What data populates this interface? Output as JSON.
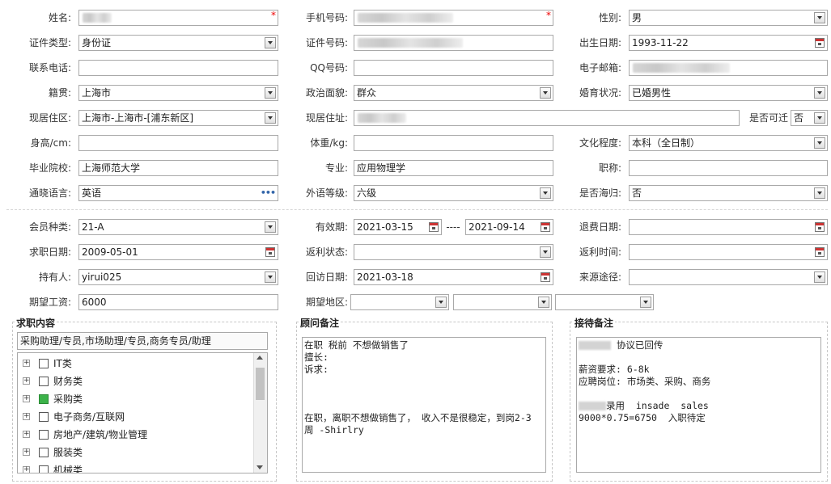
{
  "profile": {
    "name": {
      "label": "姓名:"
    },
    "mobile": {
      "label": "手机号码:"
    },
    "gender": {
      "label": "性别:",
      "value": "男"
    },
    "id_type": {
      "label": "证件类型:",
      "value": "身份证"
    },
    "id_number": {
      "label": "证件号码:"
    },
    "birth_date": {
      "label": "出生日期:",
      "value": "1993-11-22"
    },
    "phone": {
      "label": "联系电话:",
      "value": ""
    },
    "qq": {
      "label": "QQ号码:",
      "value": ""
    },
    "email": {
      "label": "电子邮箱:"
    },
    "native_place": {
      "label": "籍贯:",
      "value": "上海市"
    },
    "political": {
      "label": "政治面貌:",
      "value": "群众"
    },
    "marital": {
      "label": "婚育状况:",
      "value": "已婚男性"
    },
    "residence_area": {
      "label": "现居住区:",
      "value": "上海市-上海市-[浦东新区]"
    },
    "residence_addr": {
      "label": "现居住址:"
    },
    "relocate": {
      "label": "是否可迁",
      "value": "否"
    },
    "height": {
      "label": "身高/cm:",
      "value": ""
    },
    "weight": {
      "label": "体重/kg:",
      "value": ""
    },
    "education": {
      "label": "文化程度:",
      "value": "本科（全日制）"
    },
    "school": {
      "label": "毕业院校:",
      "value": "上海师范大学"
    },
    "major": {
      "label": "专业:",
      "value": "应用物理学"
    },
    "title": {
      "label": "职称:",
      "value": ""
    },
    "language": {
      "label": "通晓语言:",
      "value": "英语"
    },
    "lang_level": {
      "label": "外语等级:",
      "value": "六级"
    },
    "overseas": {
      "label": "是否海归:",
      "value": "否"
    }
  },
  "membership": {
    "member_type": {
      "label": "会员种类:",
      "value": "21-A"
    },
    "valid_period": {
      "label": "有效期:",
      "start": "2021-03-15",
      "sep": "----",
      "end": "2021-09-14"
    },
    "refund_date": {
      "label": "退费日期:",
      "value": ""
    },
    "job_date": {
      "label": "求职日期:",
      "value": "2009-05-01"
    },
    "rebate_status": {
      "label": "返利状态:",
      "value": ""
    },
    "rebate_time": {
      "label": "返利时间:",
      "value": ""
    },
    "holder": {
      "label": "持有人:",
      "value": "yirui025"
    },
    "visit_date": {
      "label": "回访日期:",
      "value": "2021-03-18"
    },
    "source": {
      "label": "来源途径:",
      "value": ""
    },
    "salary": {
      "label": "期望工资:",
      "value": "6000"
    },
    "region": {
      "label": "期望地区:",
      "v1": "",
      "v2": "",
      "v3": ""
    }
  },
  "job_content": {
    "title": "求职内容",
    "summary": "采购助理/专员,市场助理/专员,商务专员/助理",
    "tree": [
      {
        "label": "IT类",
        "checked": false
      },
      {
        "label": "财务类",
        "checked": false
      },
      {
        "label": "采购类",
        "checked": true
      },
      {
        "label": "电子商务/互联网",
        "checked": false
      },
      {
        "label": "房地产/建筑/物业管理",
        "checked": false
      },
      {
        "label": "服装类",
        "checked": false
      },
      {
        "label": "机械类",
        "checked": false
      }
    ]
  },
  "advisor_notes": {
    "title": "顾问备注",
    "text": "在职 税前 不想做销售了\n擅长:\n诉求:\n\n\n\n在职，离职不想做销售了， 收入不是很稳定，到岗2-3\n周 -Shirlry"
  },
  "reception_notes": {
    "title": "接待备注",
    "line1": "协议已回传",
    "body": "薪资要求: 6-8k\n应聘岗位: 市场类、采购、商务",
    "line_hire": "录用  insade  sales",
    "line_calc": "9000*0.75=6750  入职待定"
  }
}
